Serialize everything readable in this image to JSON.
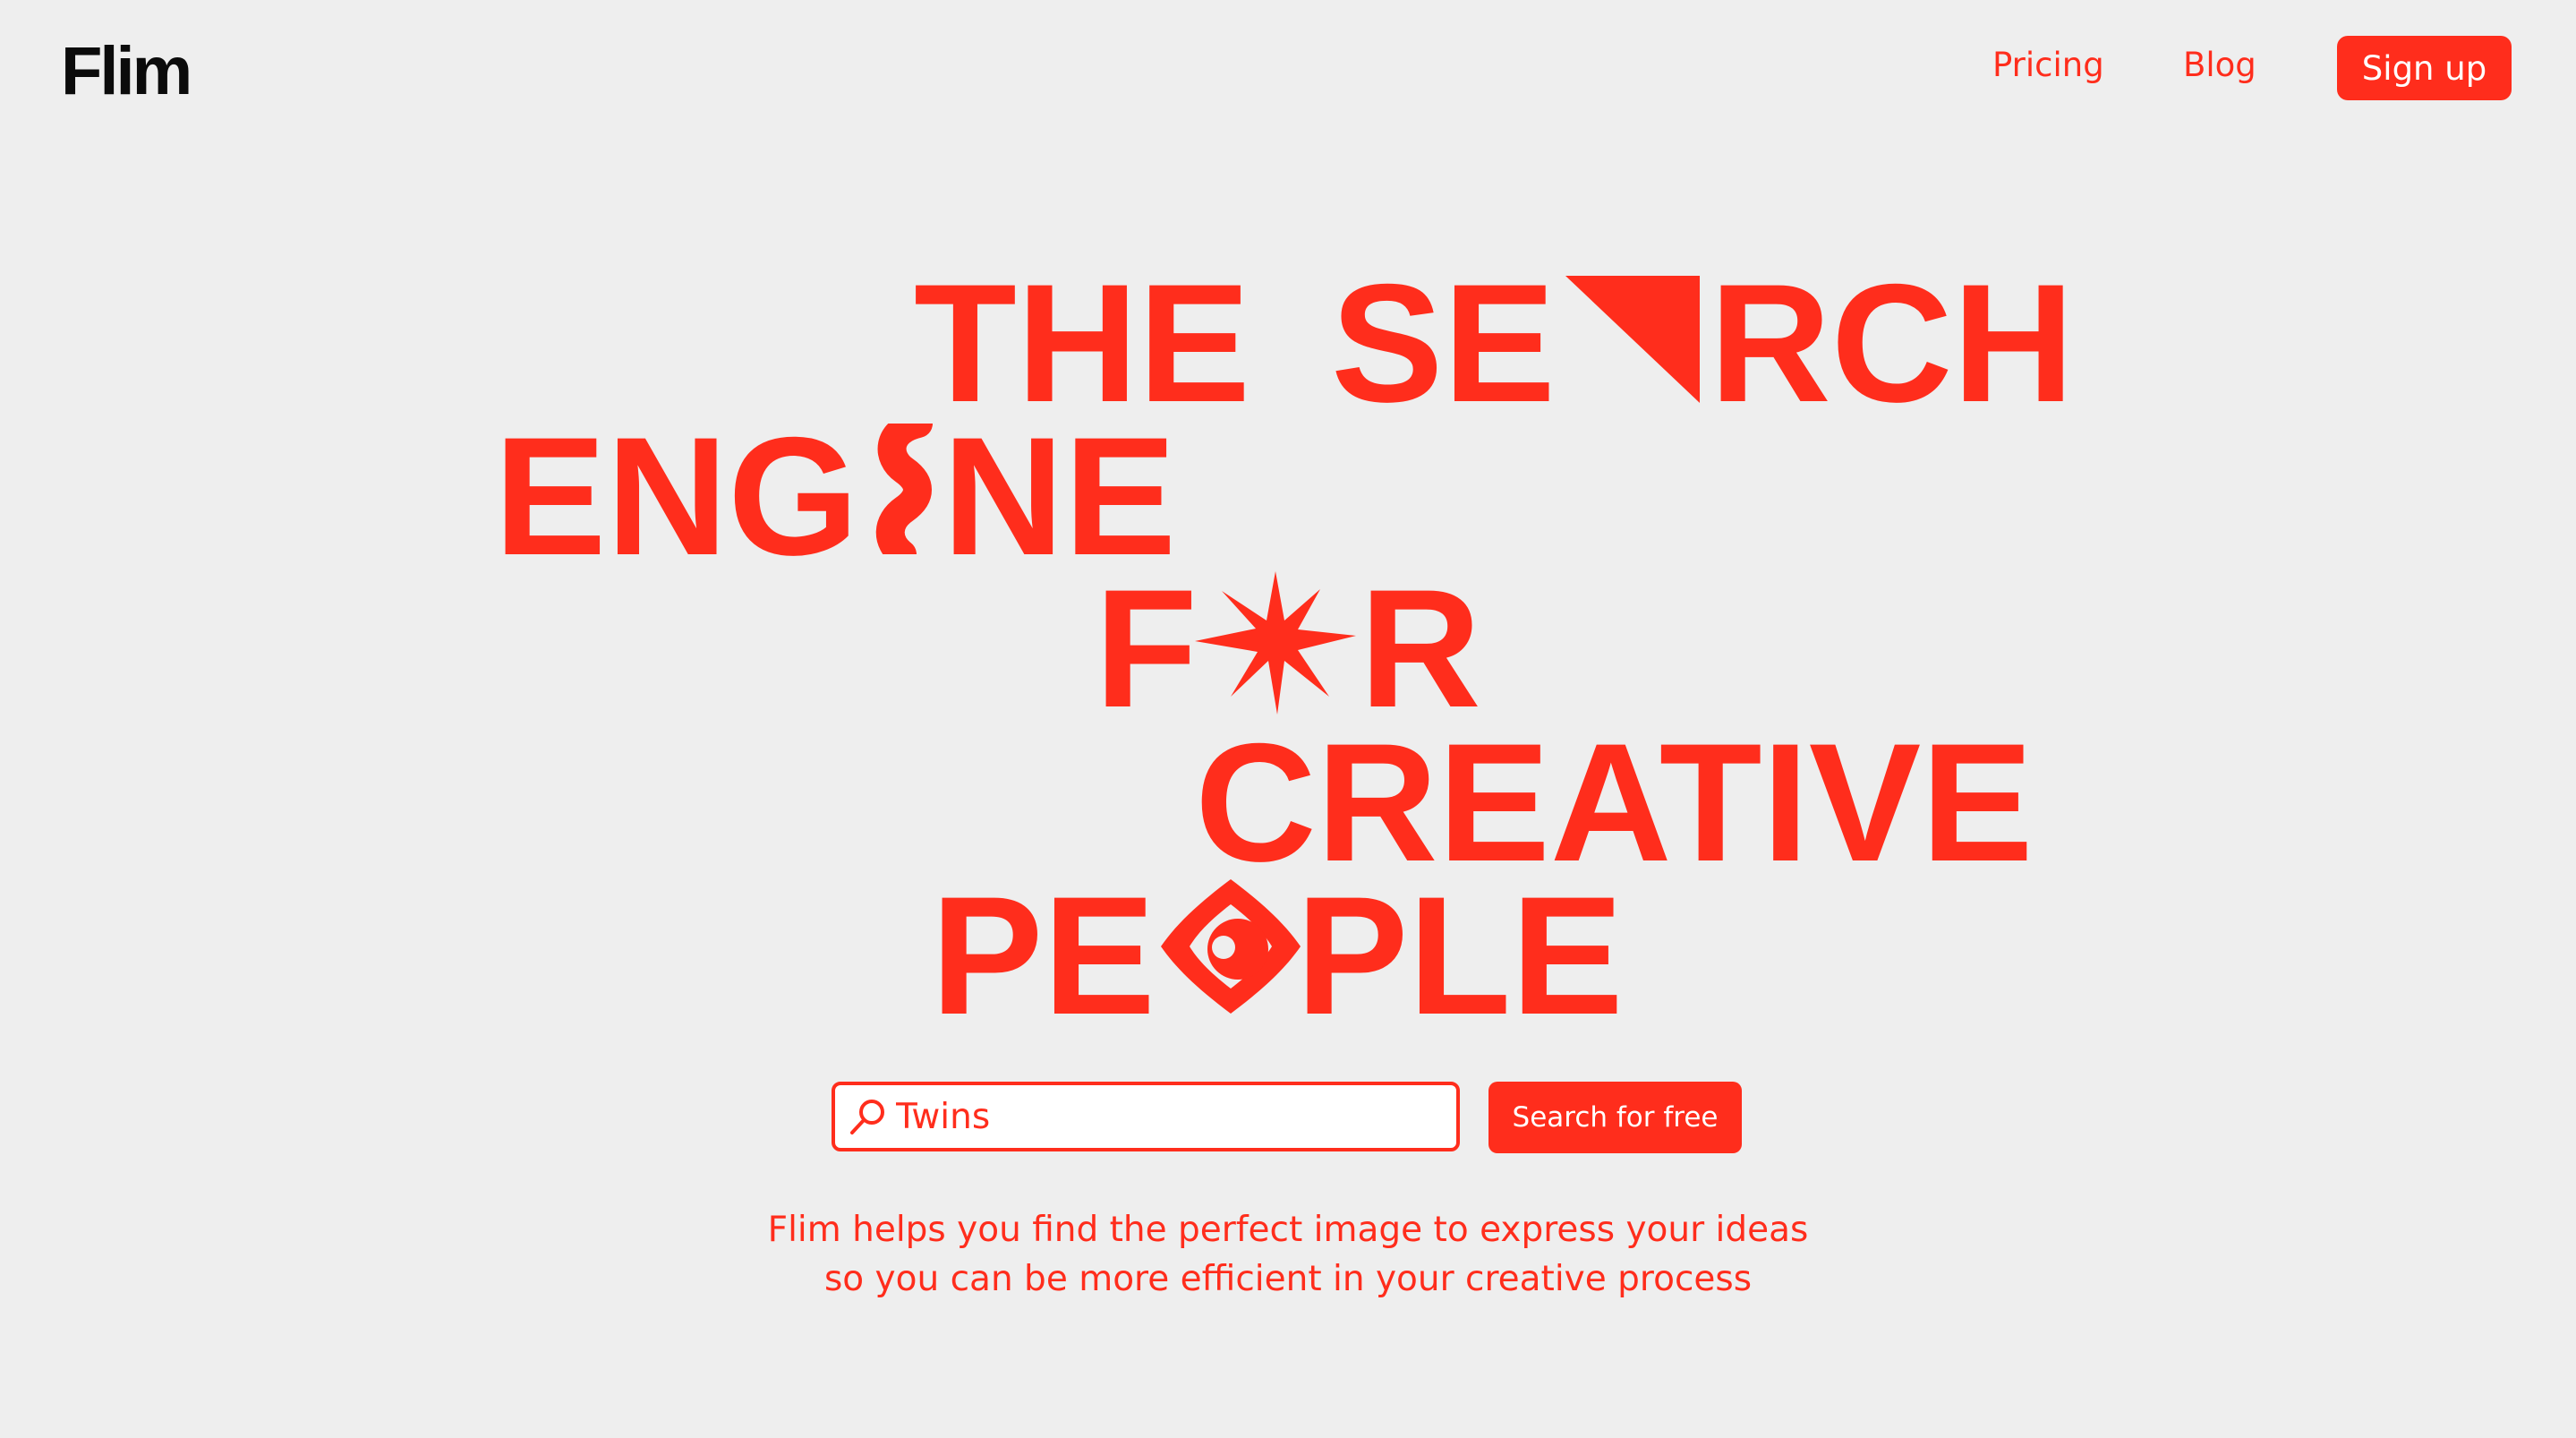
{
  "header": {
    "logo": "Flim",
    "nav": {
      "pricing": "Pricing",
      "blog": "Blog"
    },
    "signup_label": "Sign up"
  },
  "hero": {
    "line1": {
      "a": "THE",
      "b": "SE",
      "c": "RCH"
    },
    "line2": {
      "a": "ENG",
      "b": "NE"
    },
    "line3": {
      "a": "F",
      "b": "R"
    },
    "line4": {
      "a": "CREATIVE"
    },
    "line5": {
      "a": "PE",
      "b": "PLE"
    },
    "glyph_icons": [
      "triangle-a-icon",
      "squiggle-i-icon",
      "starburst-o-icon",
      "eye-o-icon"
    ]
  },
  "search": {
    "value": "Twins",
    "button_label": "Search for free"
  },
  "tagline": {
    "line1": "Flim helps you find the perfect image to express your ideas",
    "line2": "so you can be more efficient in your creative process"
  },
  "colors": {
    "accent": "#ff2d1c",
    "background": "#eeeeee",
    "logo": "#0b0b0b"
  }
}
